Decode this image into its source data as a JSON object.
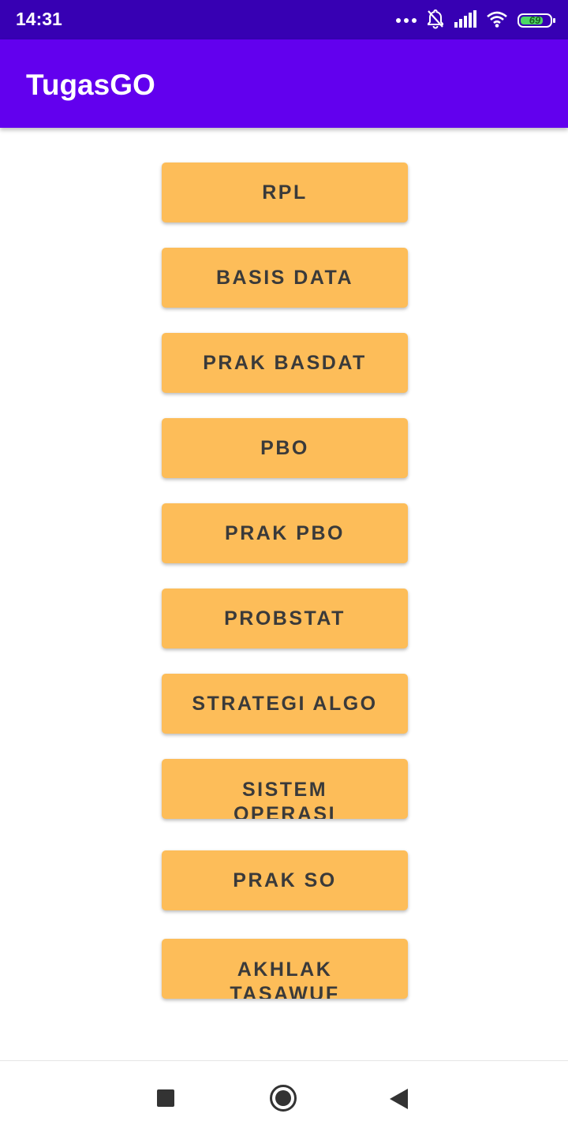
{
  "status_bar": {
    "time": "14:31",
    "battery": "69",
    "icons": [
      "more-dots-icon",
      "bell-off-icon",
      "signal-icon",
      "wifi-icon",
      "battery-icon"
    ]
  },
  "app_bar": {
    "title": "TugasGO"
  },
  "buttons": [
    {
      "label": "RPL"
    },
    {
      "label": "BASIS DATA"
    },
    {
      "label": "PRAK BASDAT"
    },
    {
      "label": "PBO"
    },
    {
      "label": "PRAK PBO"
    },
    {
      "label": "PROBSTAT"
    },
    {
      "label": "STRATEGI ALGO"
    },
    {
      "label": "SISTEM OPERASI"
    },
    {
      "label": "PRAK SO"
    },
    {
      "label": "AKHLAK TASAWUF"
    }
  ],
  "nav_bar": {
    "icons": [
      "recent-apps-icon",
      "home-icon",
      "back-icon"
    ]
  },
  "colors": {
    "status_bar": "#3700b3",
    "app_bar": "#6200ee",
    "button": "#fdbd59",
    "button_text": "#3a3a3a"
  }
}
